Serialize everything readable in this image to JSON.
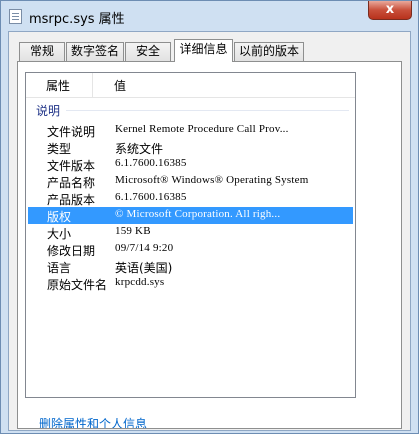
{
  "window": {
    "title": "msrpc.sys 属性",
    "close_label": "x"
  },
  "tabs": [
    {
      "label": "常规"
    },
    {
      "label": "数字签名"
    },
    {
      "label": "安全"
    },
    {
      "label": "详细信息",
      "active": true
    },
    {
      "label": "以前的版本"
    }
  ],
  "details": {
    "headers": {
      "property": "属性",
      "value": "值"
    },
    "group": "说明",
    "rows": [
      {
        "key": "文件说明",
        "value": "Kernel Remote Procedure Call Prov..."
      },
      {
        "key": "类型",
        "value": "系统文件"
      },
      {
        "key": "文件版本",
        "value": "6.1.7600.16385"
      },
      {
        "key": "产品名称",
        "value": "Microsoft® Windows® Operating System"
      },
      {
        "key": "产品版本",
        "value": "6.1.7600.16385"
      },
      {
        "key": "版权",
        "value": "© Microsoft Corporation. All righ...",
        "selected": true
      },
      {
        "key": "大小",
        "value": "159 KB"
      },
      {
        "key": "修改日期",
        "value": "09/7/14 9:20"
      },
      {
        "key": "语言",
        "value": "英语(美国)"
      },
      {
        "key": "原始文件名",
        "value": "krpcdd.sys"
      }
    ]
  },
  "footer": {
    "remove_link": "删除属性和个人信息"
  },
  "colors": {
    "selection": "#3399ff",
    "link": "#0066cc",
    "group_label": "#1e3287"
  }
}
